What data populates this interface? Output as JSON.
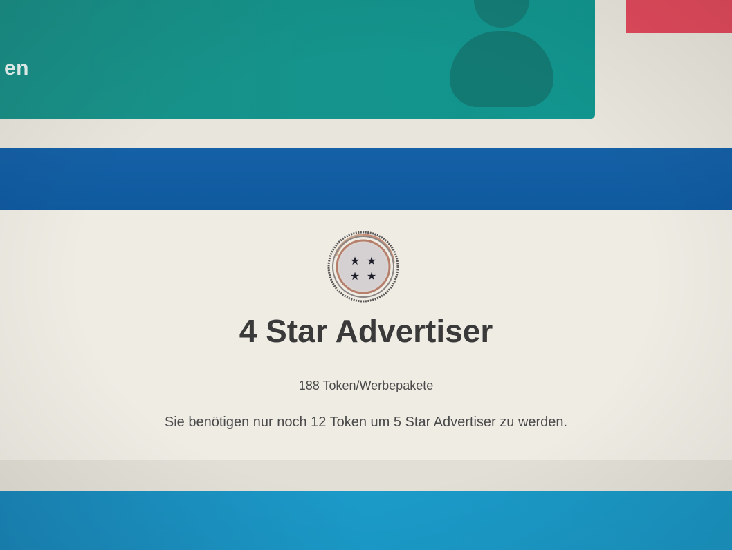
{
  "top_card": {
    "partial_text": "en",
    "color": "#14948c"
  },
  "accent_red": "#e04a5c",
  "blue_band_color": "#1560a6",
  "rank": {
    "badge_icon": "four-star-badge-icon",
    "stars": 4,
    "title": "4 Star Advertiser",
    "token_count": "188 Token/Werbepakete",
    "next_rank_hint": "Sie benötigen nur noch 12 Token um 5 Star Advertiser zu werden."
  },
  "bottom_band_color": "#1a95c2"
}
